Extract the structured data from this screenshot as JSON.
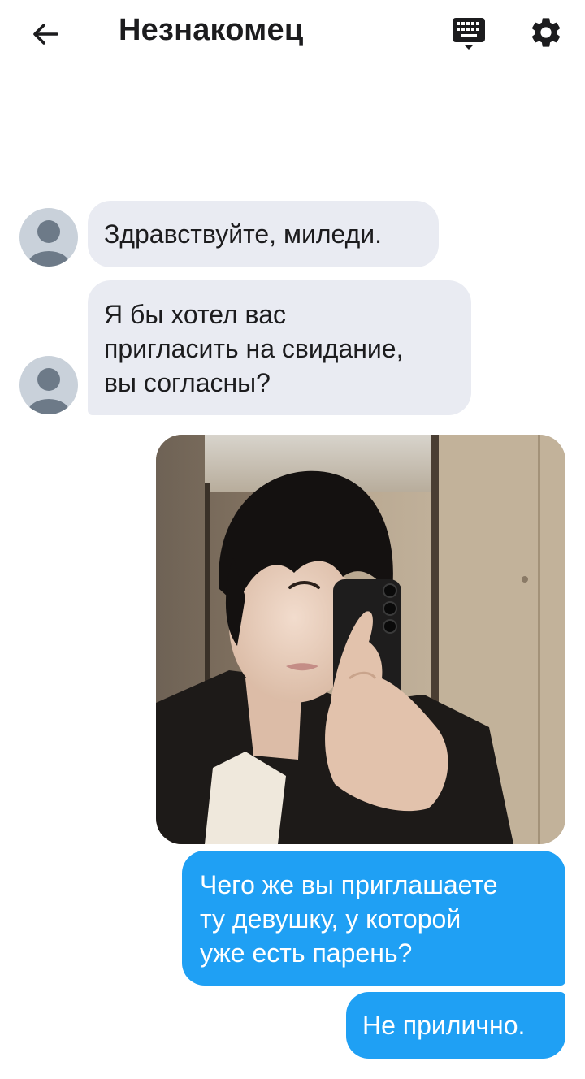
{
  "header": {
    "title": "Незнакомец",
    "back_icon": "arrow-left-icon",
    "keyboard_icon": "keyboard-icon",
    "settings_icon": "gear-icon"
  },
  "messages": [
    {
      "side": "incoming",
      "type": "text",
      "text": "Здравствуйте, миледи."
    },
    {
      "side": "incoming",
      "type": "text",
      "text": "Я бы хотел вас\nпригласить на свидание,\nвы согласны?"
    },
    {
      "side": "outgoing",
      "type": "image",
      "alt": "photo"
    },
    {
      "side": "outgoing",
      "type": "text",
      "text": "Чего же вы приглашаете\nту девушку, у которой\nуже есть парень?"
    },
    {
      "side": "outgoing",
      "type": "text",
      "text": "Не прилично."
    }
  ],
  "colors": {
    "incoming_bubble": "#e9ebf2",
    "outgoing_bubble": "#1fa0f4",
    "avatar_bg": "#c9d1da",
    "avatar_fg": "#6d7a88"
  }
}
